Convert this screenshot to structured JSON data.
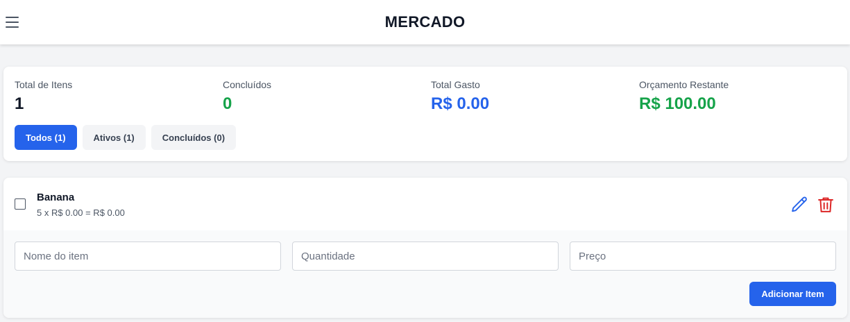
{
  "header": {
    "title": "MERCADO",
    "menu_icon": "hamburger-menu-icon"
  },
  "stats": {
    "total_items_label": "Total de Itens",
    "total_items_value": "1",
    "completed_label": "Concluídos",
    "completed_value": "0",
    "total_spent_label": "Total Gasto",
    "total_spent_value": "R$ 0.00",
    "remaining_budget_label": "Orçamento Restante",
    "remaining_budget_value": "R$ 100.00"
  },
  "filters": [
    {
      "label": "Todos (1)",
      "active": true
    },
    {
      "label": "Ativos (1)",
      "active": false
    },
    {
      "label": "Concluídos (0)",
      "active": false
    }
  ],
  "items": [
    {
      "name": "Banana",
      "detail": "5 x R$ 0.00 = R$ 0.00",
      "checked": false
    }
  ],
  "form": {
    "name_placeholder": "Nome do item",
    "quantity_placeholder": "Quantidade",
    "price_placeholder": "Preço",
    "add_button_label": "Adicionar Item"
  },
  "colors": {
    "accent_blue": "#2563eb",
    "success_green": "#16a34a",
    "danger_red": "#dc2626"
  }
}
